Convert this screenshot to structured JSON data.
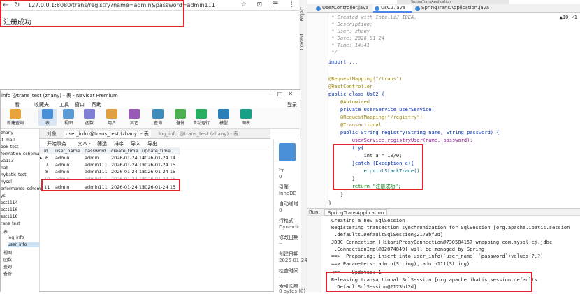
{
  "browser": {
    "url": "127.0.0.1:8080/trans/registry?name=admin&password=admin111",
    "result_text": "注册成功",
    "nav_back": "←",
    "nav_reload": "↻",
    "icons": "☆ ⊡ ☰ ⋮"
  },
  "ide": {
    "side_tabs": [
      "Project",
      "Commit"
    ],
    "tabs": [
      {
        "label": "UserController.java",
        "icon_color": "#3e86d6"
      },
      {
        "label": "UsC2.java",
        "icon_color": "#3e86d6"
      },
      {
        "label": "SpringTransApplication.java",
        "icon_color": "#3e86d6"
      }
    ],
    "window_title_tail": "SpringTransApplication",
    "warnings": "▲10 ✓1",
    "code_lines": [
      " * Created with IntelliJ IDEA.",
      " * Description:",
      " * User: zhany",
      " * Date: 2026-01-24",
      " * Time: 14:41",
      " */",
      "import ...",
      "",
      "@RequestMapping(\"/trans\")",
      "@RestController",
      "public class UsC2 {",
      "    @Autowired",
      "    private UserService userService;",
      "    @RequestMapping(\"/registry\")",
      "    @Transactional",
      "    public String registry(String name, String password) {",
      "        userService.registryUser(name, password);",
      "        try{",
      "            int a = 10/0;",
      "        }catch (Exception e){",
      "            e.printStackTrace();",
      "        }",
      "        return \"注册成功\";",
      "    }",
      "}"
    ],
    "run_label": "Run:",
    "run_config": "SpringTransApplication",
    "console_lines": [
      "Creating a new SqlSession",
      "Registering transaction synchronization for SqlSession [org.apache.ibatis.session",
      " .defaults.DefaultSqlSession@2173bf2d]",
      "JDBC Connection [HikariProxyConnection@730584157 wrapping com.mysql.cj.jdbc",
      " .ConnectionImpl@32074849] will be managed by Spring",
      "==>  Preparing: insert into user_info(`user_name`,`password`)values(?,?)",
      "==> Parameters: admin(String), admin111(String)",
      "<==    Updates: 1",
      "Releasing transactional SqlSession [org.apache.ibatis.session.defaults",
      " .DefaultSqlSession@2173bf2d]"
    ]
  },
  "navicat": {
    "title": "info @trans_test (zhany) - 表 - Navicat Premium",
    "login": "登录",
    "menu": [
      "看",
      "收藏夹",
      "工具",
      "窗口",
      "帮助"
    ],
    "toolbar": [
      {
        "label": "新建查询",
        "color": "#e8a33c"
      },
      {
        "label": "表",
        "color": "#4a90d9"
      },
      {
        "label": "视图",
        "color": "#5b9bd5"
      },
      {
        "label": "函数",
        "color": "#7f7fd5"
      },
      {
        "label": "用户",
        "color": "#e0a040"
      },
      {
        "label": "其它",
        "color": "#9b59b6"
      },
      {
        "label": "查询",
        "color": "#3c8dbc"
      },
      {
        "label": "备份",
        "color": "#4caf50"
      },
      {
        "label": "自动运行",
        "color": "#27ae60"
      },
      {
        "label": "模型",
        "color": "#2980b9"
      },
      {
        "label": "图表",
        "color": "#16a085"
      }
    ],
    "tree": [
      "zhany",
      "it_mall",
      "ook_test",
      "formation_schema",
      "va113",
      "nall",
      "nybatis_test",
      "nysql",
      "erformance_schema",
      "ys",
      "est1114",
      "est1116",
      "est1118",
      "rans_test",
      "表",
      "log_info",
      "user_info",
      "视图",
      "函数",
      "查询",
      "备份"
    ],
    "object_tab": "对象",
    "open_tabs": [
      "user_info @trans_test (zhany) - 表",
      "log_info @trans_test (zhany) - 表"
    ],
    "data_toolbar": [
      "开始事务",
      "文本 ·",
      "筛选",
      "排序",
      "导入",
      "导出"
    ],
    "columns": [
      "id",
      "user_name",
      "password",
      "create_time",
      "update_time"
    ],
    "rows": [
      [
        "6",
        "admin",
        "admin",
        "2026-01-24 14",
        "2026-01-24 14"
      ],
      [
        "7",
        "admin",
        "admin111",
        "2026-01-24 15",
        "2026-01-24 15"
      ],
      [
        "8",
        "admin",
        "admin111",
        "2026-01-24 15",
        "2026-01-24 15"
      ],
      [
        "10",
        "admin",
        "admin111",
        "2026-01-24 15",
        "2026-01-24 15"
      ],
      [
        "11",
        "admin",
        "admin111",
        "2026-01-24 15",
        "2026-01-24 15"
      ]
    ],
    "props": [
      {
        "k": "行",
        "v": "0"
      },
      {
        "k": "引擎",
        "v": "InnoDB"
      },
      {
        "k": "自动递增",
        "v": "0"
      },
      {
        "k": "行格式",
        "v": "Dynamic"
      },
      {
        "k": "修改日期",
        "v": "--"
      },
      {
        "k": "创建日期",
        "v": "2026-01-24"
      },
      {
        "k": "检查时间",
        "v": "--"
      },
      {
        "k": "索引长度",
        "v": "0 bytes (0)"
      }
    ]
  }
}
